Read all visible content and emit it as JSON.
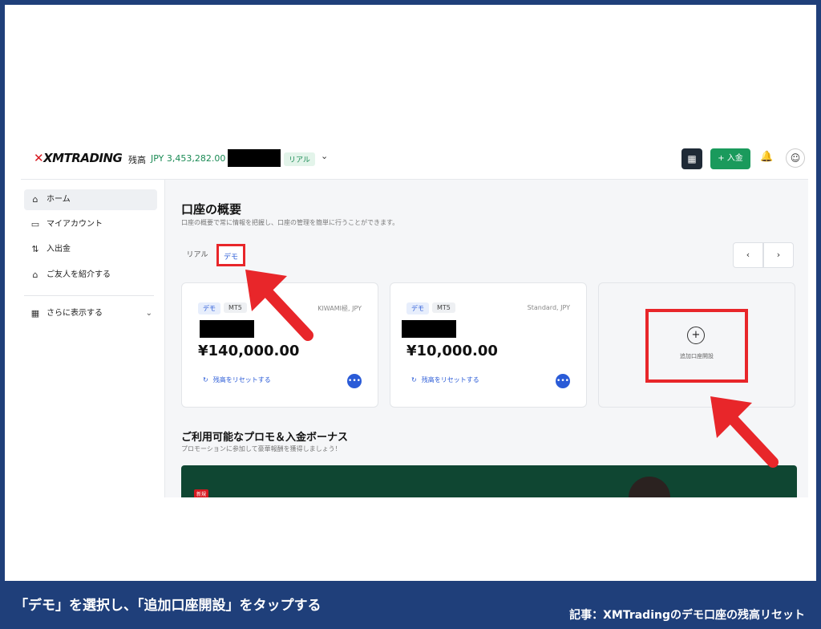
{
  "app": {
    "logo": "XMTRADING",
    "balance_label": "残高",
    "balance_value": "JPY 3,453,282.00",
    "account_badge": "リアル",
    "deposit_button": "+ 入金"
  },
  "sidebar": {
    "items": [
      {
        "label": "ホーム",
        "icon": "home-icon"
      },
      {
        "label": "マイアカウント",
        "icon": "card-icon"
      },
      {
        "label": "入出金",
        "icon": "transfer-icon"
      },
      {
        "label": "ご友人を紹介する",
        "icon": "referral-icon"
      },
      {
        "label": "さらに表示する",
        "icon": "grid-icon"
      }
    ]
  },
  "main": {
    "title": "口座の概要",
    "subtitle": "口座の概要で常に情報を把握し、口座の管理を簡単に行うことができます。",
    "tabs": [
      {
        "label": "リアル"
      },
      {
        "label": "デモ"
      }
    ],
    "cards": [
      {
        "chip_demo": "デモ",
        "chip_platform": "MT5",
        "type": "KIWAMI極, JPY",
        "amount": "¥140,000.00",
        "reset_label": "残高をリセットする",
        "more": "•••"
      },
      {
        "chip_demo": "デモ",
        "chip_platform": "MT5",
        "type": "Standard, JPY",
        "amount": "¥10,000.00",
        "reset_label": "残高をリセットする",
        "more": "•••"
      }
    ],
    "add_account_label": "追加口座開設",
    "promo_title": "ご利用可能なプロモ＆入金ボーナス",
    "promo_subtitle": "プロモーションに参加して豪華報酬を獲得しましょう！",
    "promo_badge": "新規"
  },
  "caption": "「デモ」を選択し、「追加口座開設」をタップする",
  "article": "記事：XMTradingのデモ口座の残高リセット"
}
